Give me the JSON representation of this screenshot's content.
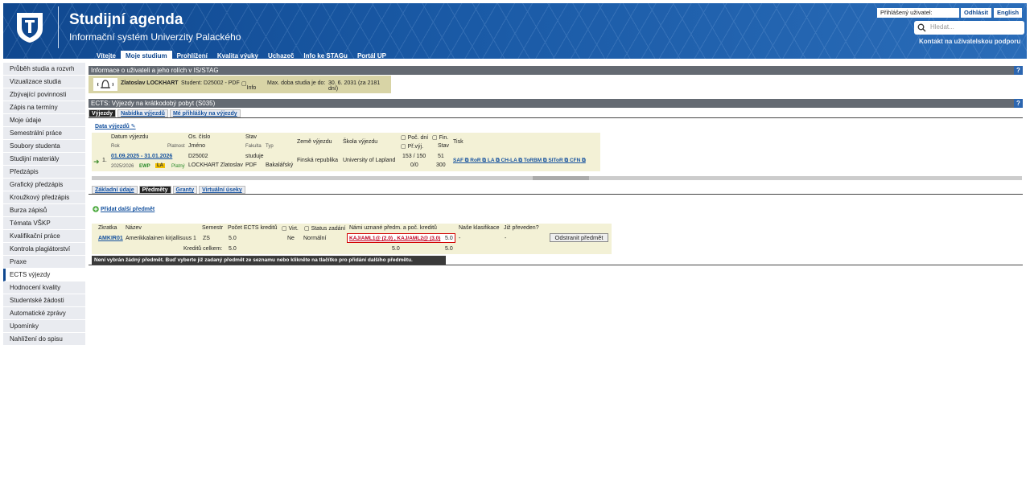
{
  "header": {
    "title": "Studijní agenda",
    "subtitle": "Informační systém Univerzity Palackého",
    "login_label": "Přihlášený uživatel:",
    "logout": "Odhlásit",
    "language": "English",
    "search_placeholder": "Hledat...",
    "support": "Kontakt na uživatelskou podporu"
  },
  "menu": [
    {
      "label": "Vítejte",
      "active": false
    },
    {
      "label": "Moje studium",
      "active": true
    },
    {
      "label": "Prohlížení",
      "active": false
    },
    {
      "label": "Kvalita výuky",
      "active": false
    },
    {
      "label": "Uchazeč",
      "active": false
    },
    {
      "label": "Info ke STAGu",
      "active": false
    },
    {
      "label": "Portál UP",
      "active": false
    }
  ],
  "sidebar": [
    "Průběh studia a rozvrh",
    "Vizualizace studia",
    "Zbývající povinnosti",
    "Zápis na termíny",
    "Moje údaje",
    "Semestrální práce",
    "Soubory studenta",
    "Studijní materiály",
    "Předzápis",
    "Grafický předzápis",
    "Kroužkový předzápis",
    "Burza zápisů",
    "Témata VŠKP",
    "Kvalifikační práce",
    "Kontrola plagiátorství",
    "Praxe",
    "ECTS výjezdy",
    "Hodnocení kvality",
    "Studentské žádosti",
    "Automatické zprávy",
    "Upomínky",
    "Nahlížení do spisu"
  ],
  "sidebar_selected": 16,
  "info": {
    "bar_title": "Informace o uživateli a jeho rolích v IS/STAG",
    "name": "Zlatoslav LOCKHART",
    "student": "Student: D25002 - PDF",
    "info_link": "Info",
    "max_label": "Max. doba studia je do:",
    "max_value": "30. 6. 2031 (za 2181 dní)"
  },
  "ects": {
    "bar_title": "ECTS: Výjezdy na krátkodobý pobyt (S035)",
    "tabs": [
      "Výjezdy",
      "Nabídka výjezdů",
      "Mé přihlášky na výjezdy"
    ],
    "data_link": "Data výjezdů",
    "headers": {
      "datum": "Datum výjezdu",
      "rok": "Rok",
      "platnost": "Platnost",
      "os_cislo": "Os. číslo",
      "jmeno": "Jméno",
      "stav": "Stav",
      "fakulta": "Fakulta",
      "typ": "Typ",
      "zeme": "Země výjezdu",
      "skola": "Škola výjezdu",
      "poc_dni": "Poč. dní",
      "fin": "Fin.",
      "pr_vyj": "Př.výj.",
      "stav2": "Stav",
      "tisk": "Tisk"
    },
    "row": {
      "num": "1.",
      "datum": "01.09.2025 - 31.01.2026",
      "rok": "2025/2026",
      "ewp": "EWP",
      "la": "LA",
      "platny": "Platný",
      "os_cislo": "D25002",
      "jmeno": "LOCKHART Zlatoslav",
      "stav": "studuje",
      "fakulta": "PDF",
      "typ": "Bakalářský",
      "zeme": "Finská republika",
      "skola": "University of Lapland",
      "poc_dni": "153 / 150",
      "pr_vyj": "0/0",
      "fin": "51",
      "stav2": "300",
      "tisk": [
        "SAF",
        "RoR",
        "LA",
        "CH-LA",
        "ToRBM",
        "SIToR",
        "CFN"
      ]
    },
    "sub_tabs": [
      "Základní údaje",
      "Předměty",
      "Granty",
      "Virtuální úseky"
    ]
  },
  "predmety": {
    "add_link": "Přidat další předmět",
    "headers": [
      "Zkratka",
      "Název",
      "Semestr",
      "Počet ECTS kreditů",
      "Virt.",
      "Status zadání",
      "Námi uznané předm. a poč. kreditů",
      "Naše klasifikace",
      "Již převeden?"
    ],
    "row": {
      "zkratka": "AMKIR01",
      "nazev": "Amerikkalainen kirjallisuus 1",
      "semestr": "ZS",
      "ects": "5.0",
      "virt": "Ne",
      "status": "Normální",
      "uznane": "KAJ/AML1@ (2.0) , KAJ/AML2@ (3.0)",
      "uznane_kredity": "5.0",
      "klasifikace": "-",
      "preveden": "-",
      "remove": "Odstranit předmět"
    },
    "total_label": "Kreditů celkem:",
    "total_ects": "5.0",
    "total_uzn": "5.0",
    "total_sum": "5.0",
    "message": "Není vybrán žádný předmět. Buď vyberte již zadaný předmět ze seznamu nebo klikněte na tlačítko pro přidání dalšího předmětu."
  }
}
